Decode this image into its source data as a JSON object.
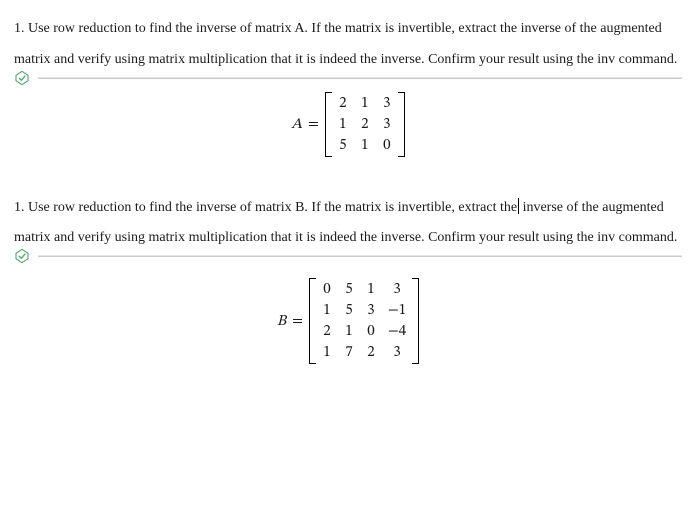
{
  "problem_a": {
    "number": "1.",
    "text_full": "1. Use row reduction to find the inverse of matrix A. If the matrix is invertible, extract the inverse of the augmented matrix and verify using matrix multiplication that it is indeed the inverse. Confirm your result using the inv command."
  },
  "problem_b": {
    "number": "1.",
    "text_full": "1. Use row reduction to find the inverse of matrix B. If the matrix is invertible, extract the inverse of the augmented matrix and verify using matrix multiplication that it is indeed the inverse. Confirm your result using the inv command."
  },
  "matrix_a": {
    "label": "A",
    "eq": "=",
    "rows": [
      [
        "2",
        "1",
        "3"
      ],
      [
        "1",
        "2",
        "3"
      ],
      [
        "5",
        "1",
        "0"
      ]
    ]
  },
  "matrix_b": {
    "label": "B",
    "eq": "=",
    "rows": [
      [
        "0",
        "5",
        "1",
        "3"
      ],
      [
        "1",
        "5",
        "3",
        "−1"
      ],
      [
        "2",
        "1",
        "0",
        "−4"
      ],
      [
        "1",
        "7",
        "2",
        "3"
      ]
    ]
  }
}
